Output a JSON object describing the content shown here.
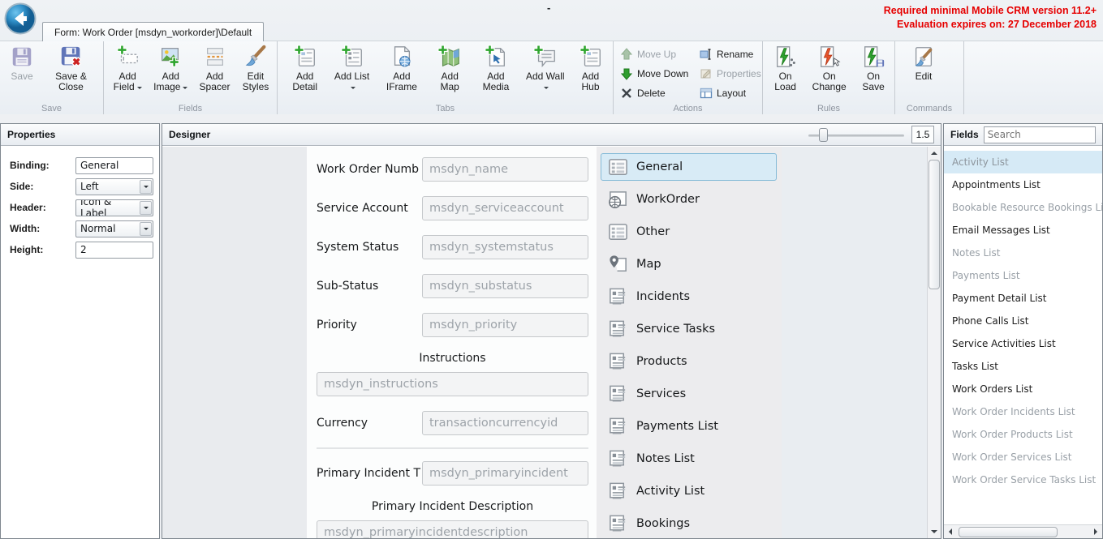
{
  "window": {
    "tab_title": "Form: Work Order [msdyn_workorder]\\Default",
    "minimize_glyph": "-"
  },
  "notice": {
    "line1": "Required minimal Mobile CRM version 11.2+",
    "line2": "Evaluation expires on: 27 December 2018",
    "color": "#e60000"
  },
  "ribbon": {
    "groups": {
      "save": {
        "label": "Save",
        "buttons": {
          "save": "Save",
          "save_close": "Save & Close"
        }
      },
      "fields": {
        "label": "Fields",
        "buttons": {
          "add_field": "Add Field",
          "add_image": "Add Image",
          "add_spacer": "Add Spacer",
          "edit_styles": "Edit Styles"
        }
      },
      "tabs": {
        "label": "Tabs",
        "buttons": {
          "add_detail": "Add Detail",
          "add_list": "Add List",
          "add_iframe": "Add IFrame",
          "add_map": "Add Map",
          "add_media": "Add Media",
          "add_wall": "Add Wall",
          "add_hub": "Add Hub"
        }
      },
      "actions": {
        "label": "Actions",
        "buttons": {
          "move_up": "Move Up",
          "move_down": "Move Down",
          "delete": "Delete",
          "rename": "Rename",
          "properties": "Properties",
          "layout": "Layout"
        }
      },
      "rules": {
        "label": "Rules",
        "buttons": {
          "on_load": "On Load",
          "on_change": "On Change",
          "on_save": "On Save"
        }
      },
      "commands": {
        "label": "Commands",
        "buttons": {
          "edit": "Edit"
        }
      }
    }
  },
  "properties_panel": {
    "title": "Properties",
    "rows": [
      {
        "label": "Binding:",
        "value": "General",
        "control": "text"
      },
      {
        "label": "Side:",
        "value": "Left",
        "control": "select"
      },
      {
        "label": "Header:",
        "value": "Icon & Label",
        "control": "select"
      },
      {
        "label": "Width:",
        "value": "Normal",
        "control": "select"
      },
      {
        "label": "Height:",
        "value": "2",
        "control": "text"
      }
    ]
  },
  "designer": {
    "title": "Designer",
    "zoom_value": "1.5",
    "form_rows": [
      {
        "layout": "inline",
        "label": "Work Order Numb",
        "value": "msdyn_name"
      },
      {
        "layout": "inline",
        "label": "Service Account",
        "value": "msdyn_serviceaccount"
      },
      {
        "layout": "inline",
        "label": "System Status",
        "value": "msdyn_systemstatus"
      },
      {
        "layout": "inline",
        "label": "Sub-Status",
        "value": "msdyn_substatus"
      },
      {
        "layout": "inline",
        "label": "Priority",
        "value": "msdyn_priority"
      },
      {
        "layout": "stacked",
        "label": "Instructions",
        "value": "msdyn_instructions"
      },
      {
        "layout": "inline",
        "label": "Currency",
        "value": "transactioncurrencyid"
      },
      {
        "layout": "separator",
        "label": "",
        "value": ""
      },
      {
        "layout": "inline",
        "label": "Primary Incident T",
        "value": "msdyn_primaryincident"
      },
      {
        "layout": "stacked",
        "label": "Primary Incident Description",
        "value": "msdyn_primaryincidentdescription"
      }
    ],
    "tabs": [
      {
        "label": "General",
        "icon": "form",
        "selected": true
      },
      {
        "label": "WorkOrder",
        "icon": "globe",
        "selected": false
      },
      {
        "label": "Other",
        "icon": "form",
        "selected": false
      },
      {
        "label": "Map",
        "icon": "map",
        "selected": false
      },
      {
        "label": "Incidents",
        "icon": "list",
        "selected": false
      },
      {
        "label": "Service Tasks",
        "icon": "list",
        "selected": false
      },
      {
        "label": "Products",
        "icon": "list",
        "selected": false
      },
      {
        "label": "Services",
        "icon": "list",
        "selected": false
      },
      {
        "label": "Payments List",
        "icon": "list",
        "selected": false
      },
      {
        "label": "Notes List",
        "icon": "list",
        "selected": false
      },
      {
        "label": "Activity List",
        "icon": "list",
        "selected": false
      },
      {
        "label": "Bookings",
        "icon": "list",
        "selected": false
      }
    ]
  },
  "fields_panel": {
    "title": "Fields",
    "search_placeholder": "Search",
    "items": [
      {
        "label": "Activity List",
        "state": "selected"
      },
      {
        "label": "Appointments List",
        "state": "available"
      },
      {
        "label": "Bookable Resource Bookings List",
        "state": "used"
      },
      {
        "label": "Email Messages List",
        "state": "available"
      },
      {
        "label": "Notes List",
        "state": "used"
      },
      {
        "label": "Payments List",
        "state": "used"
      },
      {
        "label": "Payment Detail List",
        "state": "available"
      },
      {
        "label": "Phone Calls List",
        "state": "available"
      },
      {
        "label": "Service Activities List",
        "state": "available"
      },
      {
        "label": "Tasks List",
        "state": "available"
      },
      {
        "label": "Work Orders List",
        "state": "available"
      },
      {
        "label": "Work Order Incidents List",
        "state": "used"
      },
      {
        "label": "Work Order Products List",
        "state": "used"
      },
      {
        "label": "Work Order Services List",
        "state": "used"
      },
      {
        "label": "Work Order Service Tasks List",
        "state": "used"
      }
    ]
  },
  "colors": {
    "accent_red": "#e60000",
    "selection_blue": "#d8ebf6",
    "selection_border": "#84bad7"
  }
}
